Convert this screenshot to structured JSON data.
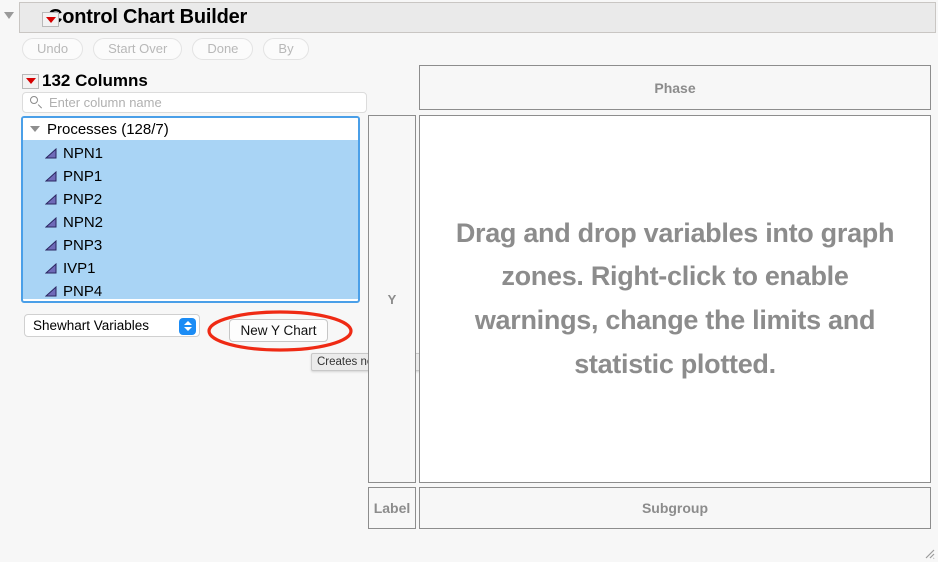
{
  "window": {
    "title": "Control Chart Builder",
    "menu_icon": "red-triangle-menu-icon",
    "disclosure_icon": "disclosure-triangle-icon"
  },
  "toolbar": {
    "buttons": [
      {
        "label": "Undo",
        "name": "undo-button"
      },
      {
        "label": "Start Over",
        "name": "start-over-button"
      },
      {
        "label": "Done",
        "name": "done-button"
      },
      {
        "label": "By",
        "name": "by-button"
      }
    ]
  },
  "columns_panel": {
    "title": "132 Columns",
    "menu_icon": "red-triangle-menu-icon",
    "search": {
      "placeholder": "Enter column name",
      "value": "",
      "icon": "search-icon"
    },
    "group": {
      "label": "Processes (128/7)",
      "expanded": true
    },
    "items": [
      {
        "label": "NPN1",
        "icon": "continuous-column-icon",
        "selected": true
      },
      {
        "label": "PNP1",
        "icon": "continuous-column-icon",
        "selected": true
      },
      {
        "label": "PNP2",
        "icon": "continuous-column-icon",
        "selected": true
      },
      {
        "label": "NPN2",
        "icon": "continuous-column-icon",
        "selected": true
      },
      {
        "label": "PNP3",
        "icon": "continuous-column-icon",
        "selected": true
      },
      {
        "label": "IVP1",
        "icon": "continuous-column-icon",
        "selected": true
      },
      {
        "label": "PNP4",
        "icon": "continuous-column-icon",
        "selected": true
      }
    ]
  },
  "chart_type_select": {
    "value": "Shewhart Variables",
    "arrows_icon": "up-down-chevrons-icon"
  },
  "new_chart_button": {
    "label": "New Y Chart"
  },
  "tooltip": {
    "text": "Creates new charts for all selected columns."
  },
  "annotation": {
    "shape": "ellipse",
    "color": "#ef2a14",
    "target": "New Y Chart"
  },
  "drop_zones": {
    "phase": "Phase",
    "y": "Y",
    "label": "Label",
    "subgroup": "Subgroup",
    "hint": "Drag and drop variables into graph zones. Right-click to enable warnings, change the limits and statistic plotted."
  },
  "colors": {
    "titlebar_bg": "#eaeaea",
    "selection_blue": "#a9d4f5",
    "focus_border": "#4a9fe8",
    "accent_blue": "#1b8cf5",
    "annotation_red": "#ef2a14",
    "zone_text": "#8c8c8c",
    "column_icon": "#4b3fa0"
  }
}
